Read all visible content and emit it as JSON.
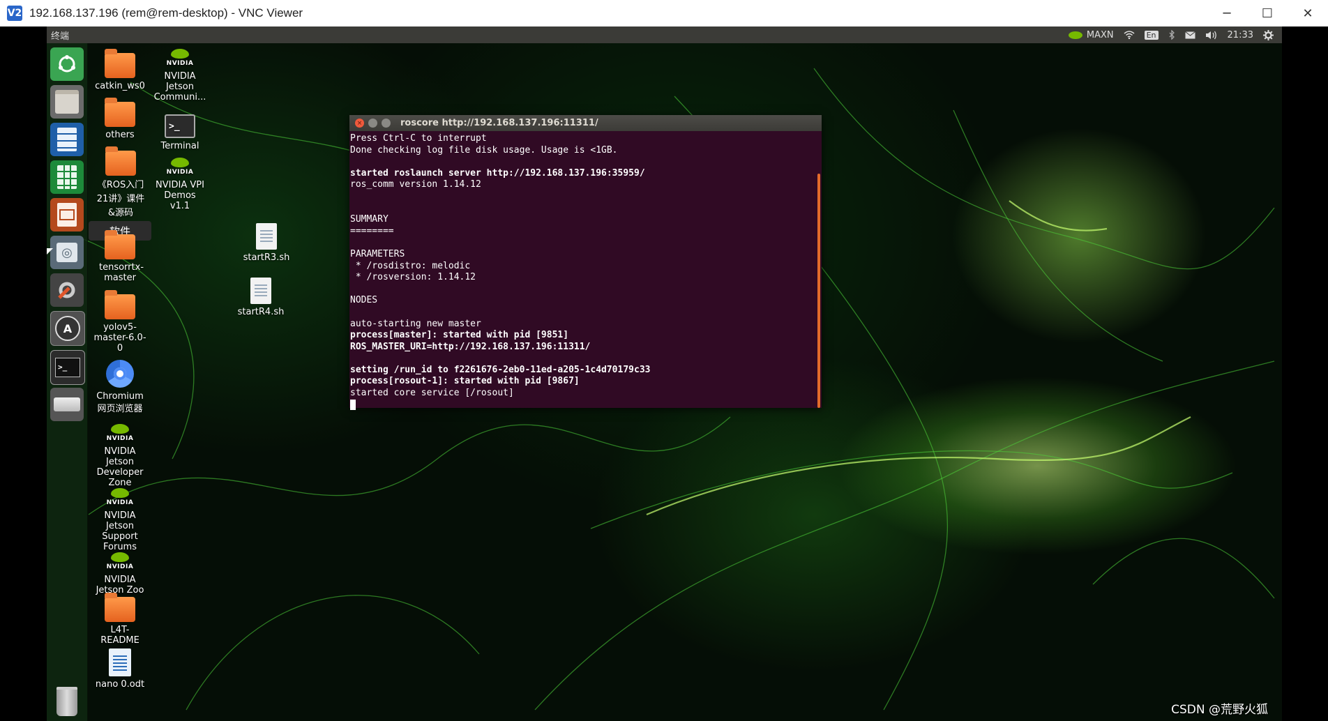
{
  "window": {
    "title": "192.168.137.196 (rem@rem-desktop) - VNC Viewer",
    "logo_text": "V2",
    "minimize": "─",
    "maximize": "☐",
    "close": "✕"
  },
  "topbar": {
    "app_name": "终端",
    "power_mode": "MAXN",
    "keyboard": "En",
    "time": "21:33"
  },
  "launcher": {
    "tooltip": "软件"
  },
  "desktop_icons": [
    {
      "label": "catkin_ws0"
    },
    {
      "label": "NVIDIA Jetson Communi..."
    },
    {
      "label": "others"
    },
    {
      "label": "Terminal"
    },
    {
      "label": "《ROS入门21讲》课件&源码"
    },
    {
      "label": "NVIDIA VPI Demos v1.1"
    },
    {
      "label": "tensorrtx-master"
    },
    {
      "label": "startR3.sh"
    },
    {
      "label": "startR4.sh"
    },
    {
      "label": "yolov5-master-6.0-0"
    },
    {
      "label": "Chromium 网页浏览器"
    },
    {
      "label": "NVIDIA Jetson Developer Zone"
    },
    {
      "label": "NVIDIA Jetson Support Forums"
    },
    {
      "label": "NVIDIA Jetson Zoo"
    },
    {
      "label": "L4T-README"
    },
    {
      "label": "nano 0.odt"
    }
  ],
  "nvidia_word": "NVIDIA",
  "terminal": {
    "title": "roscore http://192.168.137.196:11311/",
    "lines": [
      {
        "text": "Press Ctrl-C to interrupt",
        "bold": false
      },
      {
        "text": "Done checking log file disk usage. Usage is <1GB.",
        "bold": false
      },
      {
        "text": "",
        "bold": false
      },
      {
        "text": "started roslaunch server http://192.168.137.196:35959/",
        "bold": true
      },
      {
        "text": "ros_comm version 1.14.12",
        "bold": false
      },
      {
        "text": "",
        "bold": false
      },
      {
        "text": "",
        "bold": false
      },
      {
        "text": "SUMMARY",
        "bold": false
      },
      {
        "text": "========",
        "bold": false
      },
      {
        "text": "",
        "bold": false
      },
      {
        "text": "PARAMETERS",
        "bold": false
      },
      {
        "text": " * /rosdistro: melodic",
        "bold": false
      },
      {
        "text": " * /rosversion: 1.14.12",
        "bold": false
      },
      {
        "text": "",
        "bold": false
      },
      {
        "text": "NODES",
        "bold": false
      },
      {
        "text": "",
        "bold": false
      },
      {
        "text": "auto-starting new master",
        "bold": false
      },
      {
        "text": "process[master]: started with pid [9851]",
        "bold": true
      },
      {
        "text": "ROS_MASTER_URI=http://192.168.137.196:11311/",
        "bold": true
      },
      {
        "text": "",
        "bold": false
      },
      {
        "text": "setting /run_id to f2261676-2eb0-11ed-a205-1c4d70179c33",
        "bold": true
      },
      {
        "text": "process[rosout-1]: started with pid [9867]",
        "bold": true
      },
      {
        "text": "started core service [/rosout]",
        "bold": false
      }
    ]
  },
  "watermark": "CSDN @荒野火狐"
}
